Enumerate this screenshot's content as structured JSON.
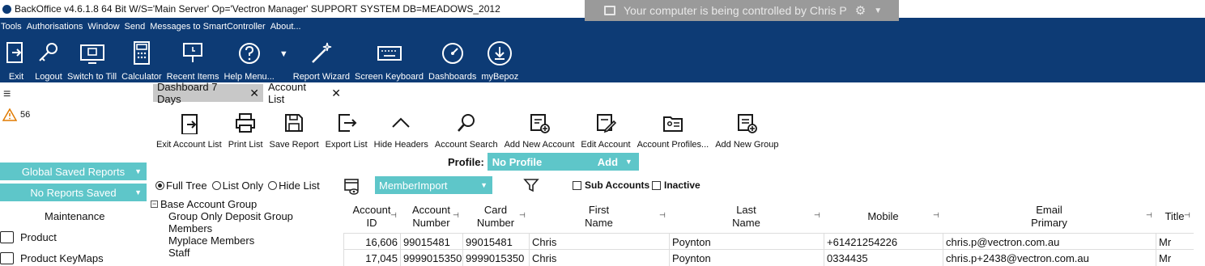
{
  "window": {
    "title": "BackOffice v4.6.1.8 64 Bit W/S='Main Server'  Op='Vectron Manager'  SUPPORT SYSTEM DB=MEADOWS_2012",
    "remote_banner": "Your computer is being controlled by Chris P"
  },
  "menu": [
    "Tools",
    "Authorisations",
    "Window",
    "Send",
    "Messages to SmartController",
    "About..."
  ],
  "toolbar": [
    {
      "label": "Exit",
      "icon": "exit-icon"
    },
    {
      "label": "Logout",
      "icon": "key-icon"
    },
    {
      "label": "Switch to Till",
      "icon": "till-icon"
    },
    {
      "label": "Calculator",
      "icon": "calculator-icon"
    },
    {
      "label": "Recent Items",
      "icon": "recent-items-icon"
    },
    {
      "label": "Help Menu...",
      "icon": "help-icon"
    },
    {
      "label": "Report Wizard",
      "icon": "wand-icon"
    },
    {
      "label": "Screen Keyboard",
      "icon": "keyboard-icon"
    },
    {
      "label": "Dashboards",
      "icon": "gauge-icon"
    },
    {
      "label": "myBepoz",
      "icon": "mybepoz-icon"
    }
  ],
  "alerts": {
    "count": "56"
  },
  "tabs": [
    {
      "label": "Dashboard 7 Days",
      "active": false
    },
    {
      "label": "Account List",
      "active": true
    }
  ],
  "actions": [
    {
      "label": "Exit Account List",
      "icon": "exit-icon"
    },
    {
      "label": "Print List",
      "icon": "printer-icon"
    },
    {
      "label": "Save Report",
      "icon": "save-icon"
    },
    {
      "label": "Export List",
      "icon": "export-icon"
    },
    {
      "label": "Hide Headers",
      "icon": "chevron-up-icon"
    },
    {
      "label": "Account Search",
      "icon": "search-icon"
    },
    {
      "label": "Add New Account",
      "icon": "add-account-icon"
    },
    {
      "label": "Edit Account",
      "icon": "edit-icon"
    },
    {
      "label": "Account Profiles...",
      "icon": "profile-card-icon"
    },
    {
      "label": "Add New Group",
      "icon": "add-group-icon"
    }
  ],
  "profile": {
    "label": "Profile:",
    "value": "No Profile",
    "add": "Add"
  },
  "sidebar": {
    "global_saved_reports": "Global Saved Reports",
    "no_reports_saved": "No Reports Saved",
    "maintenance": "Maintenance",
    "items": [
      "Product",
      "Product KeyMaps"
    ]
  },
  "view_options": {
    "full_tree": "Full Tree",
    "list_only": "List Only",
    "hide_list": "Hide List",
    "selected": "full_tree"
  },
  "member_import": "MemberImport",
  "checkboxes": {
    "sub_accounts": "Sub Accounts",
    "inactive": "Inactive"
  },
  "tree": {
    "root": "Base Account Group",
    "children": [
      "Group Only Deposit Group",
      "Members",
      "Myplace Members",
      "Staff"
    ]
  },
  "grid": {
    "columns": [
      {
        "h1": "Account",
        "h2": "ID"
      },
      {
        "h1": "Account",
        "h2": "Number"
      },
      {
        "h1": "Card",
        "h2": "Number"
      },
      {
        "h1": "First",
        "h2": "Name"
      },
      {
        "h1": "Last",
        "h2": "Name"
      },
      {
        "h1": "Mobile",
        "h2": ""
      },
      {
        "h1": "Email",
        "h2": "Primary"
      },
      {
        "h1": "Title",
        "h2": ""
      }
    ],
    "rows": [
      [
        "16,606",
        "99015481",
        "99015481",
        "Chris",
        "Poynton",
        "+61421254226",
        "chris.p@vectron.com.au",
        "Mr"
      ],
      [
        "17,045",
        "9999015350",
        "9999015350",
        "Chris",
        "Poynton",
        "0334435",
        "chris.p+2438@vectron.com.au",
        "Mr"
      ]
    ]
  },
  "colors": {
    "navy": "#0d3b75",
    "teal": "#5ec6c9",
    "tab_inactive": "#c8c8c8",
    "alert": "#e07a00"
  }
}
